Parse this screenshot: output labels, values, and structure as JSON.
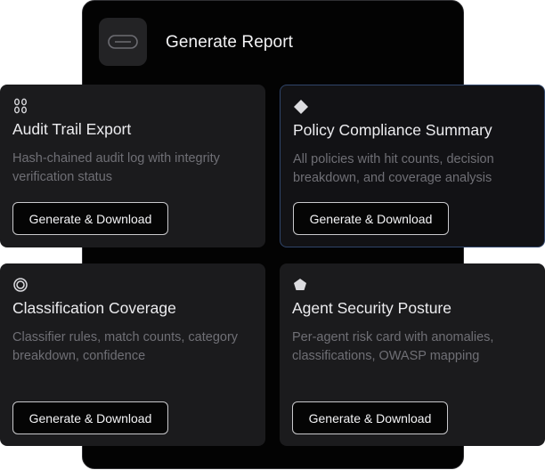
{
  "header": {
    "title": "Generate Report",
    "icon": "link-icon"
  },
  "cards": [
    {
      "icon": "chain-links-icon",
      "title": "Audit Trail Export",
      "description": "Hash-chained audit log with integrity verification status",
      "button_label": "Generate & Download"
    },
    {
      "icon": "diamond-icon",
      "title": "Policy Compliance Summary",
      "description": "All policies with hit counts, decision breakdown, and coverage analysis",
      "button_label": "Generate & Download"
    },
    {
      "icon": "target-circle-icon",
      "title": "Classification Coverage",
      "description": "Classifier rules, match counts, category breakdown, confidence",
      "button_label": "Generate & Download"
    },
    {
      "icon": "pentagon-icon",
      "title": "Agent Security Posture",
      "description": "Per-agent risk card with anomalies, classifications, OWASP mapping",
      "button_label": "Generate & Download"
    }
  ],
  "colors": {
    "panel_background": "#030303",
    "card_background": "#1b1b1d",
    "selected_border": "#30456a",
    "muted_text": "#6f6f75"
  }
}
